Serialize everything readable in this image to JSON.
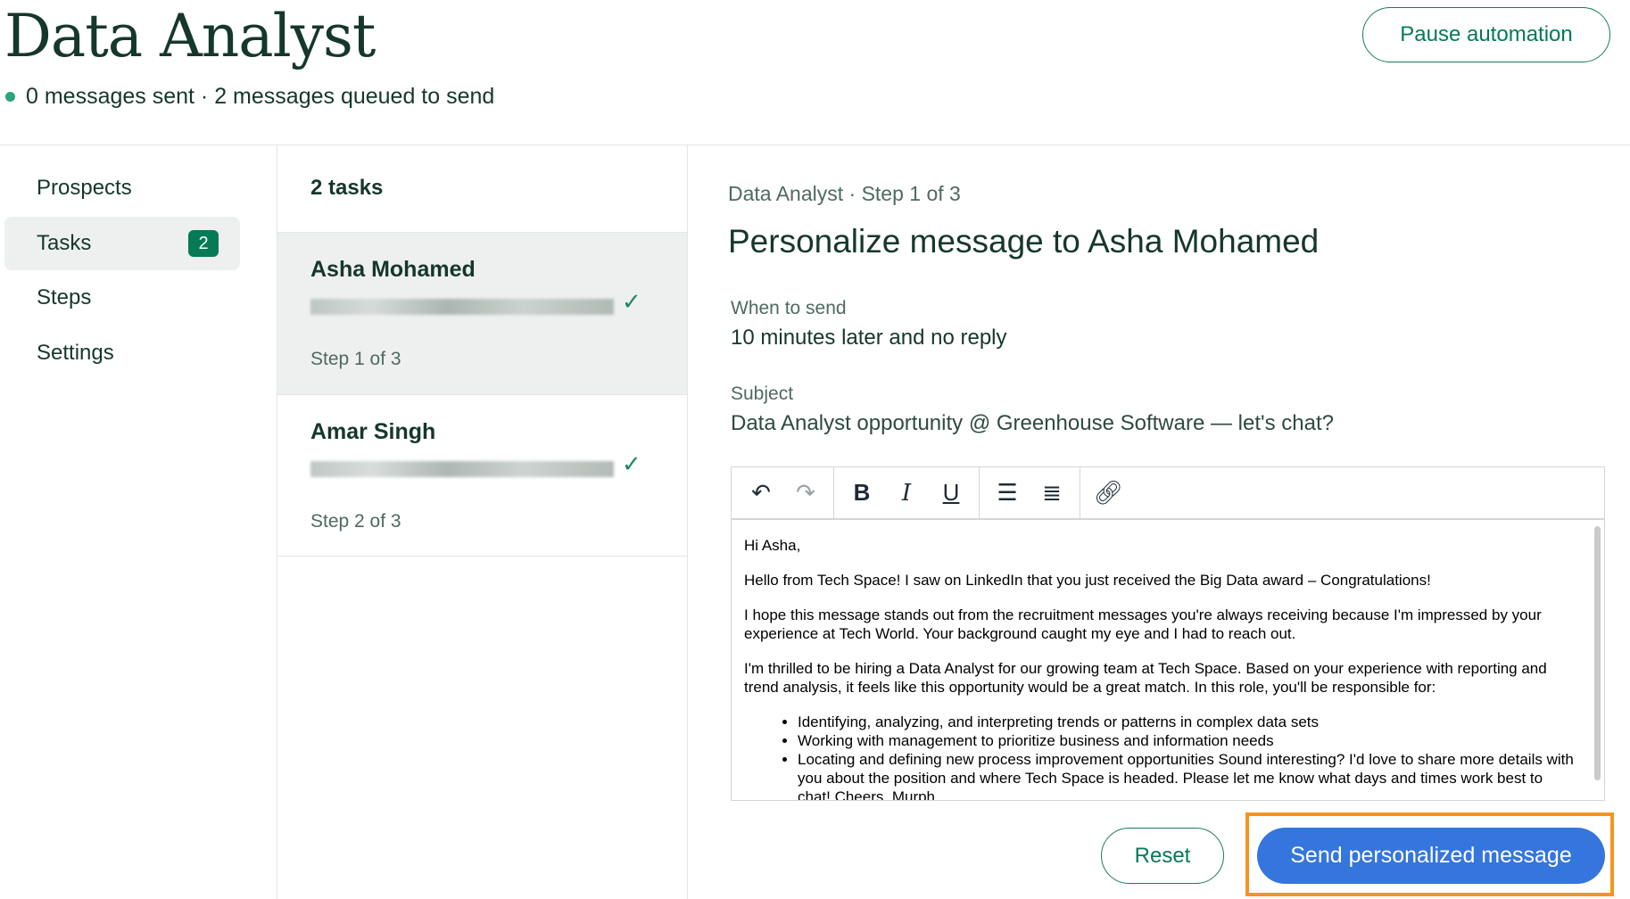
{
  "header": {
    "title": "Data Analyst",
    "status": "0 messages sent · 2 messages queued to send",
    "pause_label": "Pause automation"
  },
  "sidebar": {
    "items": [
      {
        "label": "Prospects"
      },
      {
        "label": "Tasks",
        "badge": "2",
        "selected": true
      },
      {
        "label": "Steps"
      },
      {
        "label": "Settings"
      }
    ]
  },
  "tasks": {
    "heading": "2 tasks",
    "items": [
      {
        "name": "Asha Mohamed",
        "step": "Step 1 of 3",
        "selected": true
      },
      {
        "name": "Amar Singh",
        "step": "Step 2 of 3"
      }
    ]
  },
  "main": {
    "breadcrumb": "Data Analyst · Step 1 of 3",
    "title": "Personalize message to Asha Mohamed",
    "when_label": "When to send",
    "when_value": "10 minutes later and no reply",
    "subject_label": "Subject",
    "subject_value": "Data Analyst opportunity @ Greenhouse Software — let's chat?",
    "toolbar": [
      "undo-icon",
      "redo-icon",
      "bold-icon",
      "italic-icon",
      "underline-icon",
      "bulleted-list-icon",
      "numbered-list-icon",
      "link-icon"
    ],
    "body": {
      "p1": "Hi Asha,",
      "p2": "Hello from Tech Space! I saw on LinkedIn that you just received the Big Data award – Congratulations!",
      "p3": "I hope this message stands out from the recruitment messages you're always receiving because I'm impressed by your experience at Tech World. Your background caught my eye and I had to reach out.",
      "p4": "I'm thrilled to be hiring a Data Analyst for our growing team at Tech Space. Based on your experience with reporting and trend analysis, it feels like this opportunity would be a great match. In this role, you'll be responsible for:",
      "bullets": [
        "Identifying, analyzing, and interpreting trends or patterns in complex data sets",
        "Working with management to prioritize business and information needs",
        "Locating and defining new process improvement opportunities Sound interesting? I'd love to share more details with you about the position and where Tech Space is headed. Please let me know what days and times work best to chat! Cheers, Murph"
      ]
    },
    "reset_label": "Reset",
    "send_label": "Send personalized message"
  },
  "colors": {
    "brand": "#047a55",
    "send": "#3575de",
    "highlight": "#f7931e"
  }
}
